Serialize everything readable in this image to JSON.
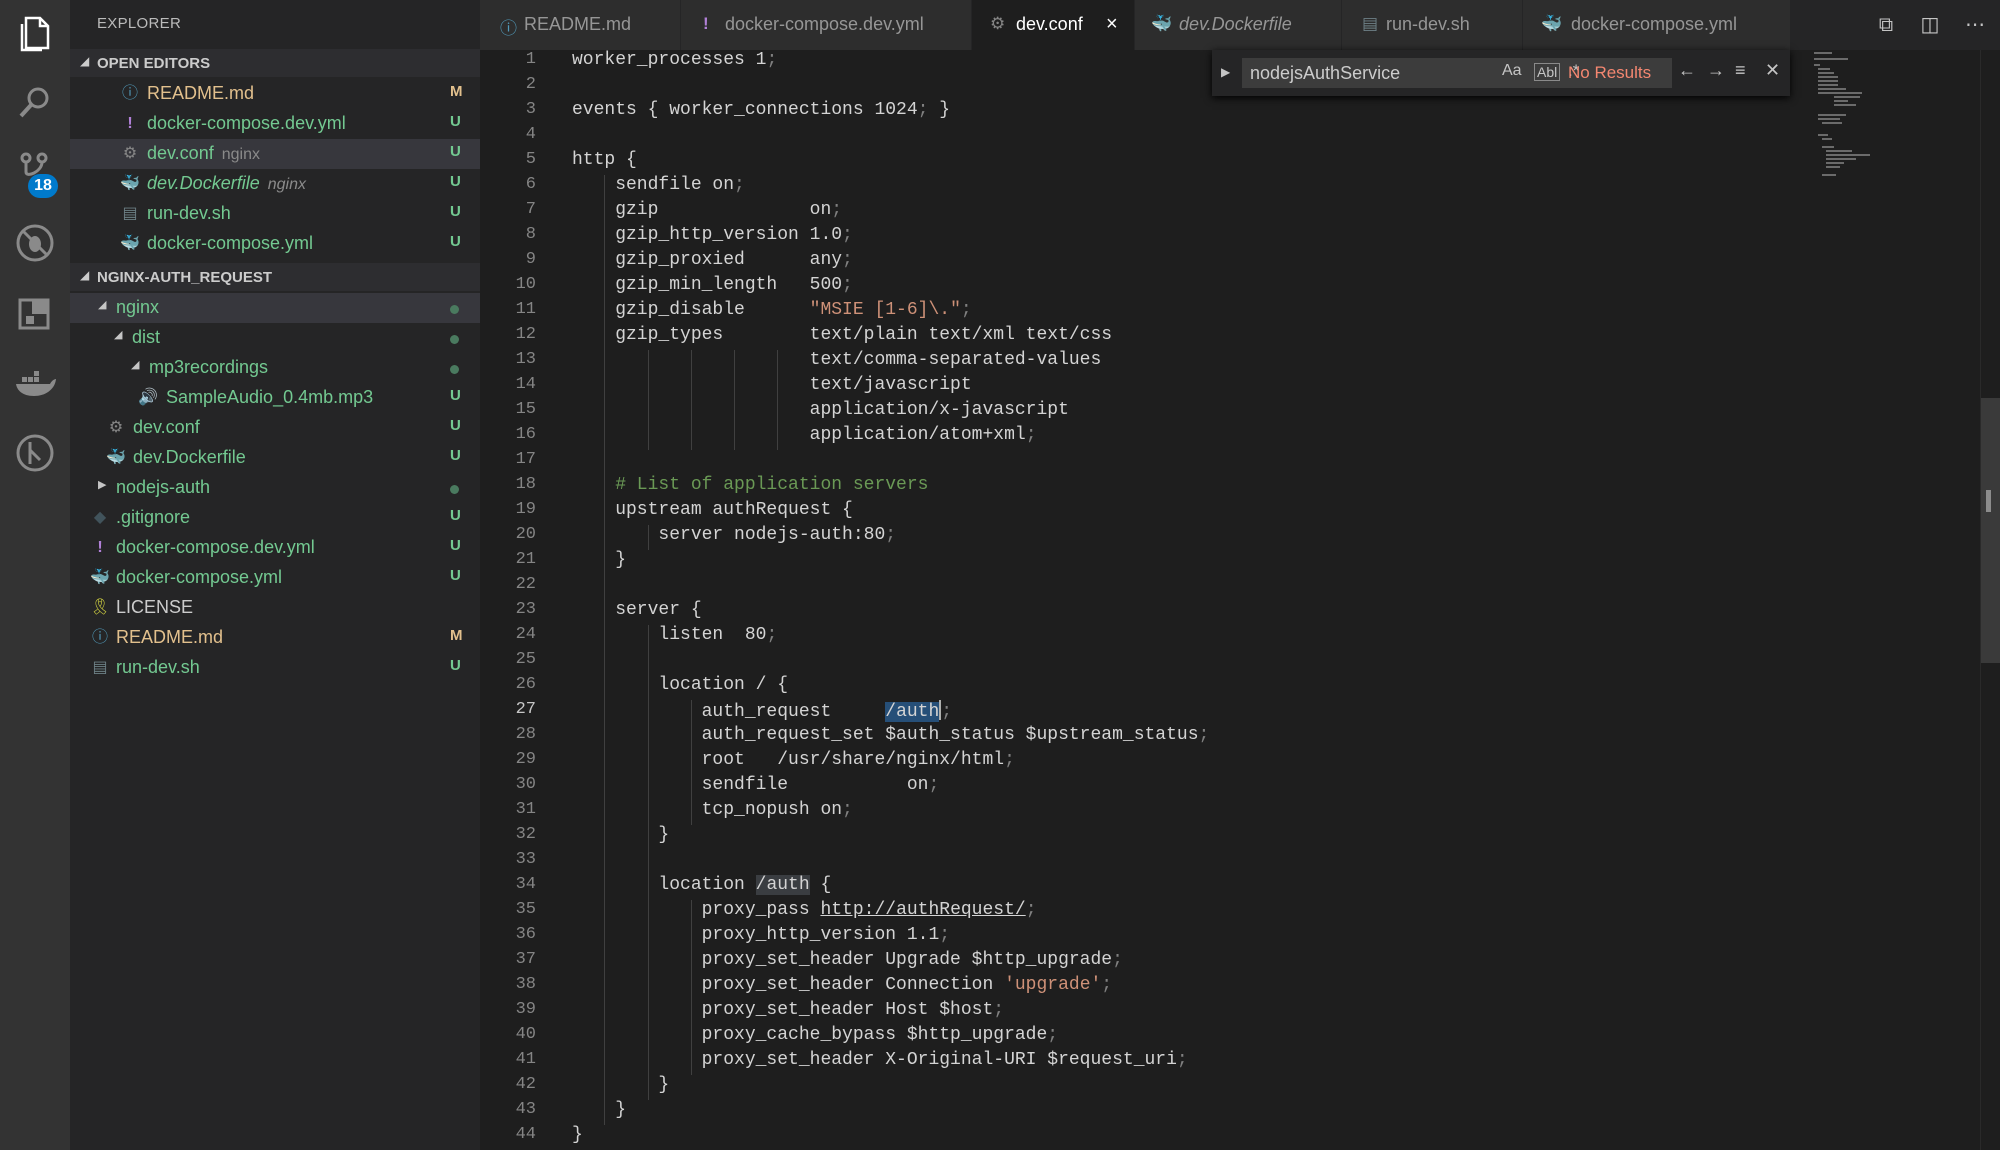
{
  "sidebar": {
    "title": "EXPLORER",
    "open_editors": {
      "header": "OPEN EDITORS",
      "items": [
        {
          "icon": "info-icon",
          "name": "README.md",
          "status": "M"
        },
        {
          "icon": "yaml-icon",
          "name": "docker-compose.dev.yml",
          "status": "U"
        },
        {
          "icon": "gear-icon",
          "name": "dev.conf",
          "desc": "nginx",
          "status": "U"
        },
        {
          "icon": "docker-icon",
          "name": "dev.Dockerfile",
          "desc": "nginx",
          "status": "U"
        },
        {
          "icon": "file-icon",
          "name": "run-dev.sh",
          "status": "U"
        },
        {
          "icon": "docker-compose-icon",
          "name": "docker-compose.yml",
          "status": "U"
        }
      ]
    },
    "workspace": {
      "header": "NGINX-AUTH_REQUEST",
      "items": [
        {
          "name": "nginx"
        },
        {
          "name": "dist"
        },
        {
          "name": "mp3recordings"
        },
        {
          "icon": "audio-icon",
          "name": "SampleAudio_0.4mb.mp3",
          "status": "U"
        },
        {
          "icon": "gear-icon",
          "name": "dev.conf",
          "status": "U"
        },
        {
          "icon": "docker-icon",
          "name": "dev.Dockerfile",
          "status": "U"
        },
        {
          "name": "nodejs-auth"
        },
        {
          "icon": "git-icon",
          "name": ".gitignore",
          "status": "U"
        },
        {
          "icon": "yaml-icon",
          "name": "docker-compose.dev.yml",
          "status": "U"
        },
        {
          "icon": "docker-compose-icon",
          "name": "docker-compose.yml",
          "status": "U"
        },
        {
          "icon": "license-icon",
          "name": "LICENSE"
        },
        {
          "icon": "info-icon",
          "name": "README.md",
          "status": "M"
        },
        {
          "icon": "file-icon",
          "name": "run-dev.sh",
          "status": "U"
        }
      ]
    }
  },
  "activity": {
    "scm_badge": "18"
  },
  "tabs": [
    {
      "icon": "info-icon",
      "label": "README.md"
    },
    {
      "icon": "yaml-icon",
      "label": "docker-compose.dev.yml"
    },
    {
      "icon": "gear-icon",
      "label": "dev.conf",
      "active": true
    },
    {
      "icon": "docker-icon",
      "label": "dev.Dockerfile"
    },
    {
      "icon": "file-icon",
      "label": "run-dev.sh"
    },
    {
      "icon": "docker-compose-icon",
      "label": "docker-compose.yml"
    }
  ],
  "find": {
    "query": "nodejsAuthService",
    "results": "No Results",
    "match_case": "Aa",
    "whole_word": "Abl"
  },
  "editor": {
    "current_line": 27,
    "lines": [
      "worker_processes 1;",
      "",
      "events { worker_connections 1024; }",
      "",
      "http {",
      "    sendfile on;",
      "    gzip              on;",
      "    gzip_http_version 1.0;",
      "    gzip_proxied      any;",
      "    gzip_min_length   500;",
      "    gzip_disable      \"MSIE [1-6]\\.\";",
      "    gzip_types        text/plain text/xml text/css",
      "                      text/comma-separated-values",
      "                      text/javascript",
      "                      application/x-javascript",
      "                      application/atom+xml;",
      "",
      "    # List of application servers",
      "    upstream authRequest {",
      "        server nodejs-auth:80;",
      "    }",
      "",
      "    server {",
      "        listen  80;",
      "",
      "        location / {",
      "            auth_request     /auth;",
      "            auth_request_set $auth_status $upstream_status;",
      "            root   /usr/share/nginx/html;",
      "            sendfile           on;",
      "            tcp_nopush on;",
      "        }",
      "",
      "        location /auth {",
      "            proxy_pass http://authRequest/;",
      "            proxy_http_version 1.1;",
      "            proxy_set_header Upgrade $http_upgrade;",
      "            proxy_set_header Connection 'upgrade';",
      "            proxy_set_header Host $host;",
      "            proxy_cache_bypass $http_upgrade;",
      "            proxy_set_header X-Original-URI $request_uri;",
      "        }",
      "    }",
      "}"
    ]
  }
}
